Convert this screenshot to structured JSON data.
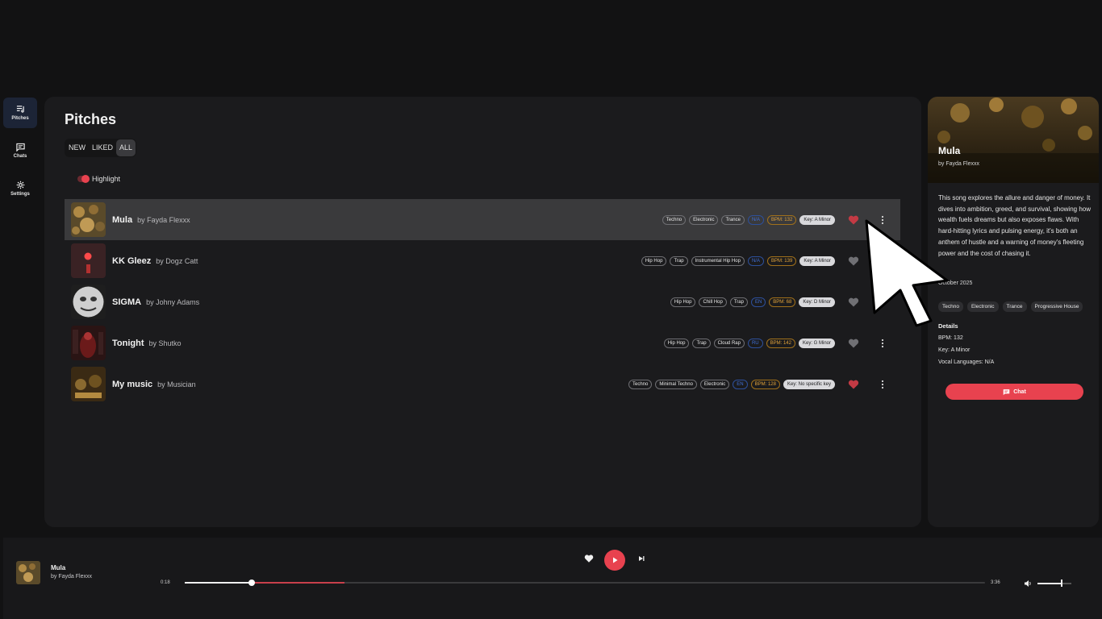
{
  "nav": [
    {
      "label": "Pitches",
      "icon": "playlist-icon",
      "active": true
    },
    {
      "label": "Chats",
      "icon": "chat-icon",
      "active": false
    },
    {
      "label": "Settings",
      "icon": "gear-icon",
      "active": false
    }
  ],
  "page": {
    "title": "Pitches"
  },
  "filters": [
    "NEW",
    "LIKED",
    "ALL"
  ],
  "highlight_label": "Highlight",
  "songs": [
    {
      "title": "Mula",
      "artist": "by Fayda Flexxx",
      "tags": [
        "Techno",
        "Electronic",
        "Trance"
      ],
      "lang": "N/A",
      "bpm": "BPM: 132",
      "key": "Key: A Minor",
      "liked": true
    },
    {
      "title": "KK Gleez",
      "artist": "by Dogz Catt",
      "tags": [
        "Hip Hop",
        "Trap",
        "Instrumental Hip Hop"
      ],
      "lang": "N/A",
      "bpm": "BPM: 139",
      "key": "Key: A Minor",
      "liked": false
    },
    {
      "title": "SIGMA",
      "artist": "by Johny Adams",
      "tags": [
        "Hip Hop",
        "Chill Hop",
        "Trap"
      ],
      "lang": "EN",
      "bpm": "BPM: 68",
      "key": "Key: D Minor",
      "liked": false
    },
    {
      "title": "Tonight",
      "artist": "by Shutko",
      "tags": [
        "Hip Hop",
        "Trap",
        "Cloud Rap"
      ],
      "lang": "RU",
      "bpm": "BPM: 142",
      "key": "Key: G Minor",
      "liked": false
    },
    {
      "title": "My music",
      "artist": "by Musician",
      "tags": [
        "Techno",
        "Minimal Techno",
        "Electronic"
      ],
      "lang": "EN",
      "bpm": "BPM: 128",
      "key": "Key: No specific key",
      "liked": true
    }
  ],
  "detail": {
    "title": "Mula",
    "artist": "by Fayda Flexxx",
    "description": "This song explores the allure and danger of money. It dives into ambition, greed, and survival, showing how wealth fuels dreams but also exposes flaws. With hard-hitting lyrics and pulsing energy, it's both an anthem of hustle and a warning of money's fleeting power and the cost of chasing it.",
    "date": "October 2025",
    "tags": [
      "Techno",
      "Electronic",
      "Trance",
      "Progressive House"
    ],
    "details_heading": "Details",
    "bpm": "BPM: 132",
    "key": "Key: A Minor",
    "vocal": "Vocal Languages: N/A",
    "chat_label": "Chat"
  },
  "player": {
    "title": "Mula",
    "artist": "by Fayda Flexxx",
    "elapsed": "0:18",
    "duration": "3:36",
    "progress": 0.084,
    "buffered": 0.2,
    "volume": 0.7
  },
  "colors": {
    "accent": "#e8424f",
    "bpm": "#e1a23a",
    "lang": "#3f6fd6"
  }
}
